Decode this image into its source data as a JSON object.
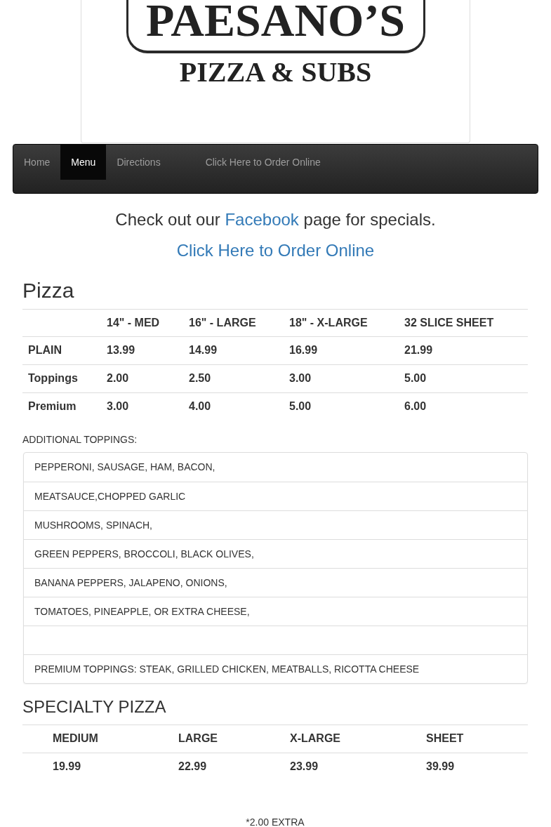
{
  "logo": {
    "name": "PAESANO’S",
    "tagline": "PIZZA & SUBS"
  },
  "navbar": {
    "items": [
      {
        "label": "Home",
        "selected": false
      },
      {
        "label": "Menu",
        "selected": true
      },
      {
        "label": "Directions",
        "selected": false
      },
      {
        "label": "Click Here to Order Online",
        "selected": false
      }
    ]
  },
  "promo": {
    "text_before": "Check out our",
    "link": "Facebook",
    "text_after": "page for specials."
  },
  "order_link": "Click Here to Order Online",
  "pizza": {
    "title": "Pizza",
    "columns": [
      "14\" - MED",
      "16\" - LARGE",
      "18\" - X-LARGE",
      "32 SLICE SHEET"
    ],
    "rows": [
      {
        "label": "PLAIN",
        "cells": [
          "13.99",
          "14.99",
          "16.99",
          "21.99"
        ]
      },
      {
        "label": "Toppings",
        "cells": [
          "2.00",
          "2.50",
          "3.00",
          "5.00"
        ]
      },
      {
        "label": "Premium",
        "cells": [
          "3.00",
          "4.00",
          "5.00",
          "6.00"
        ]
      }
    ]
  },
  "additional_toppings": {
    "label": "ADDITIONAL TOPPINGS:",
    "items": [
      {
        "kind": "text",
        "text": "PEPPERONI, SAUSAGE, HAM, BACON,"
      },
      {
        "kind": "text",
        "text": "MEATSAUCE,CHOPPED GARLIC"
      },
      {
        "kind": "text",
        "text": "MUSHROOMS, SPINACH,"
      },
      {
        "kind": "text",
        "text": "GREEN PEPPERS, BROCCOLI, BLACK OLIVES,"
      },
      {
        "kind": "text",
        "text": "BANANA PEPPERS, JALAPENO, ONIONS,"
      },
      {
        "kind": "text",
        "text": "TOMATOES, PINEAPPLE, OR EXTRA CHEESE,"
      },
      {
        "kind": "blank"
      },
      {
        "kind": "text",
        "text": "PREMIUM TOPPINGS: STEAK, GRILLED CHICKEN, MEATBALLS, RICOTTA CHEESE"
      }
    ]
  },
  "specialty": {
    "title": "SPECIALTY PIZZA",
    "columns": [
      "MEDIUM",
      "LARGE",
      "X-LARGE",
      "SHEET"
    ],
    "rows": [
      [
        "19.99",
        "22.99",
        "23.99",
        "39.99"
      ]
    ],
    "note": "*2.00 EXTRA"
  }
}
